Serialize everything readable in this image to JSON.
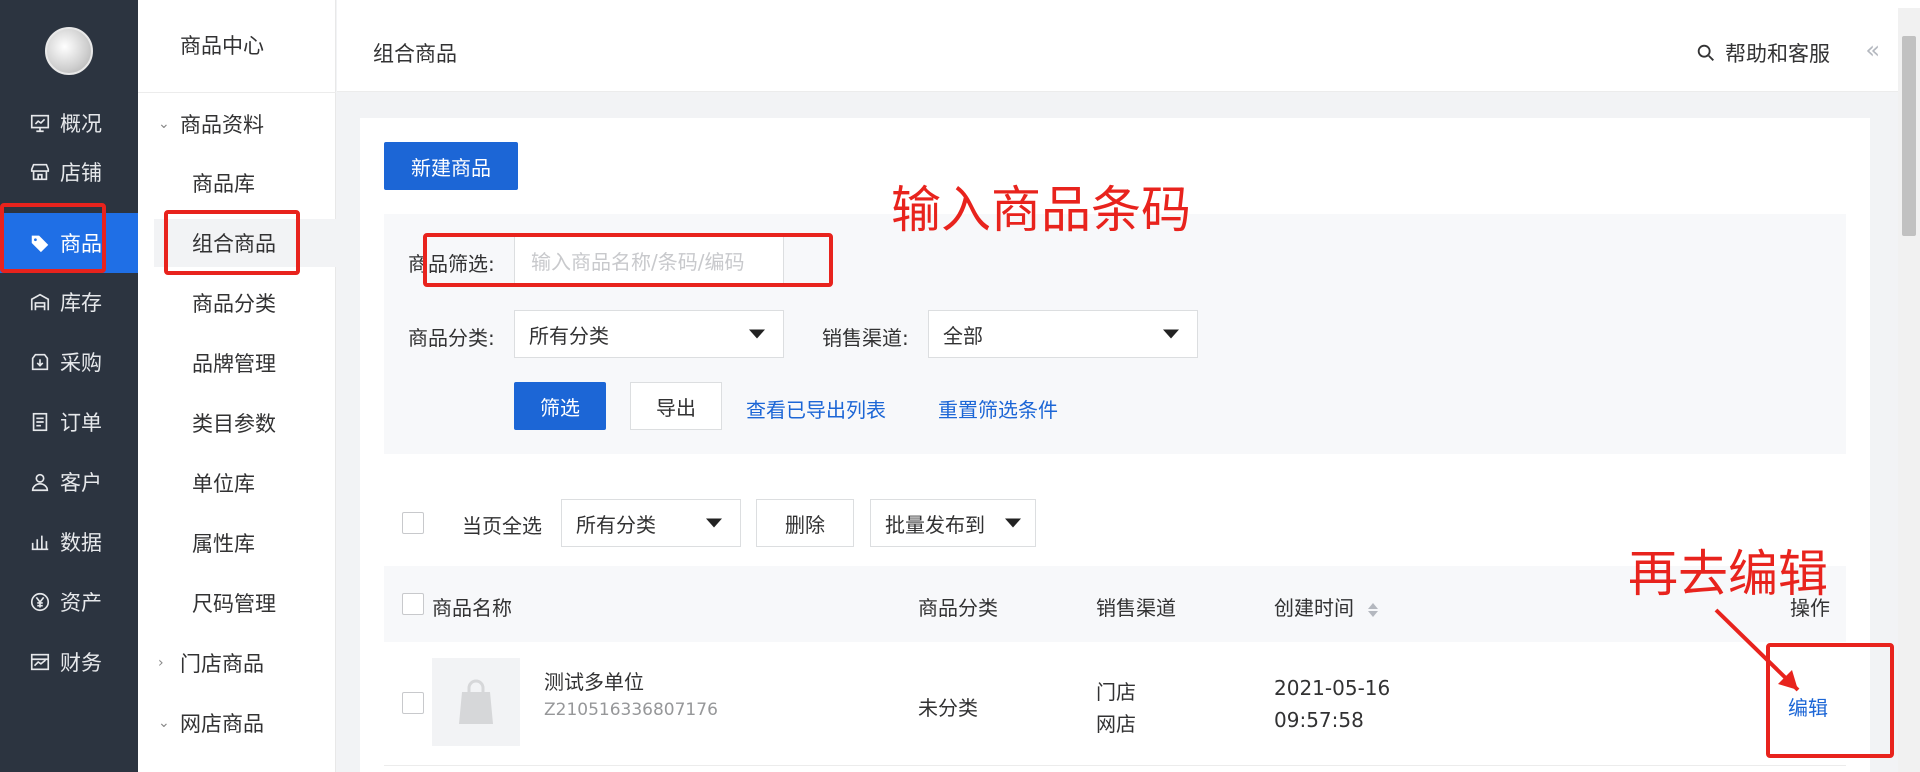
{
  "sidebar": {
    "items": [
      {
        "label": "概况",
        "icon": "monitor-icon"
      },
      {
        "label": "店铺",
        "icon": "store-icon"
      },
      {
        "label": "商品",
        "icon": "tag-icon"
      },
      {
        "label": "库存",
        "icon": "warehouse-icon"
      },
      {
        "label": "采购",
        "icon": "purchase-icon"
      },
      {
        "label": "订单",
        "icon": "order-icon"
      },
      {
        "label": "客户",
        "icon": "user-icon"
      },
      {
        "label": "数据",
        "icon": "bar-chart-icon"
      },
      {
        "label": "资产",
        "icon": "yen-icon"
      },
      {
        "label": "财务",
        "icon": "finance-icon"
      }
    ],
    "active_color": "#1f6fe6"
  },
  "subnav": {
    "title": "商品中心",
    "groups": [
      {
        "label": "商品资料"
      },
      {
        "label": "门店商品"
      },
      {
        "label": "网店商品"
      }
    ],
    "items": [
      "商品库",
      "组合商品",
      "商品分类",
      "品牌管理",
      "类目参数",
      "单位库",
      "属性库",
      "尺码管理"
    ]
  },
  "topbar": {
    "title": "组合商品",
    "help": "帮助和客服",
    "collapse": "«"
  },
  "toolbar": {
    "new_button": "新建商品"
  },
  "filter": {
    "search_label": "商品筛选:",
    "search_placeholder": "输入商品名称/条码/编码",
    "category_label": "商品分类:",
    "category_value": "所有分类",
    "channel_label": "销售渠道:",
    "channel_value": "全部",
    "filter_button": "筛选",
    "export_button": "导出",
    "view_exported_link": "查看已导出列表",
    "reset_link": "重置筛选条件"
  },
  "bulk": {
    "select_all": "当页全选",
    "category_value": "所有分类",
    "delete_button": "删除",
    "publish_button": "批量发布到"
  },
  "table": {
    "headers": [
      "商品名称",
      "商品分类",
      "销售渠道",
      "创建时间",
      "操作"
    ],
    "rows": [
      {
        "name": "测试多单位",
        "code": "Z210516336807176",
        "category": "未分类",
        "channels": [
          "门店",
          "网店"
        ],
        "date": "2021-05-16",
        "time": "09:57:58",
        "action": "编辑"
      }
    ]
  },
  "annotations": {
    "input_hint": "输入商品条码",
    "edit_hint": "再去编辑",
    "color": "#e8231d"
  }
}
